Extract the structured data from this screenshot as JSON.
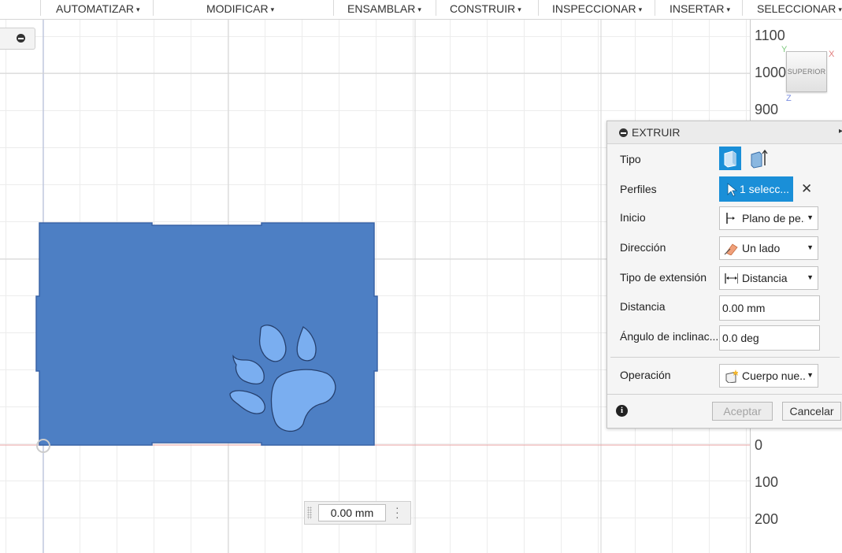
{
  "toolbar": {
    "menus": [
      {
        "label": "AUTOMATIZAR"
      },
      {
        "label": "MODIFICAR"
      },
      {
        "label": "ENSAMBLAR"
      },
      {
        "label": "CONSTRUIR"
      },
      {
        "label": "INSPECCIONAR"
      },
      {
        "label": "INSERTAR"
      },
      {
        "label": "SELECCIONAR"
      }
    ],
    "arrow": "▾"
  },
  "ruler": {
    "ticks": [
      "1100",
      "1000",
      "900",
      "0",
      "100",
      "200"
    ]
  },
  "viewcube": {
    "face_label": "SUPERIOR",
    "axis_x": "X",
    "axis_y": "Y",
    "axis_z": "Z"
  },
  "distance_input": {
    "value": "0.00 mm"
  },
  "extrude_panel": {
    "title": "EXTRUIR",
    "rows": {
      "tipo": {
        "label": "Tipo"
      },
      "perfiles": {
        "label": "Perfiles",
        "value": "1 selecc..."
      },
      "inicio": {
        "label": "Inicio",
        "value": "Plano de pe..."
      },
      "direccion": {
        "label": "Dirección",
        "value": "Un lado"
      },
      "tipo_extension": {
        "label": "Tipo de extensión",
        "value": "Distancia"
      },
      "distancia": {
        "label": "Distancia",
        "value": "0.00 mm"
      },
      "angulo": {
        "label": "Ángulo de inclinac...",
        "value": "0.0 deg"
      },
      "operacion": {
        "label": "Operación",
        "value": "Cuerpo nue..."
      }
    },
    "accept_label": "Aceptar",
    "cancel_label": "Cancelar",
    "info_symbol": "i",
    "clear_symbol": "✕"
  },
  "colors": {
    "accent": "#1a8fd8",
    "profile_fill": "#4d7fc4",
    "paw_fill": "#7aaef0"
  }
}
